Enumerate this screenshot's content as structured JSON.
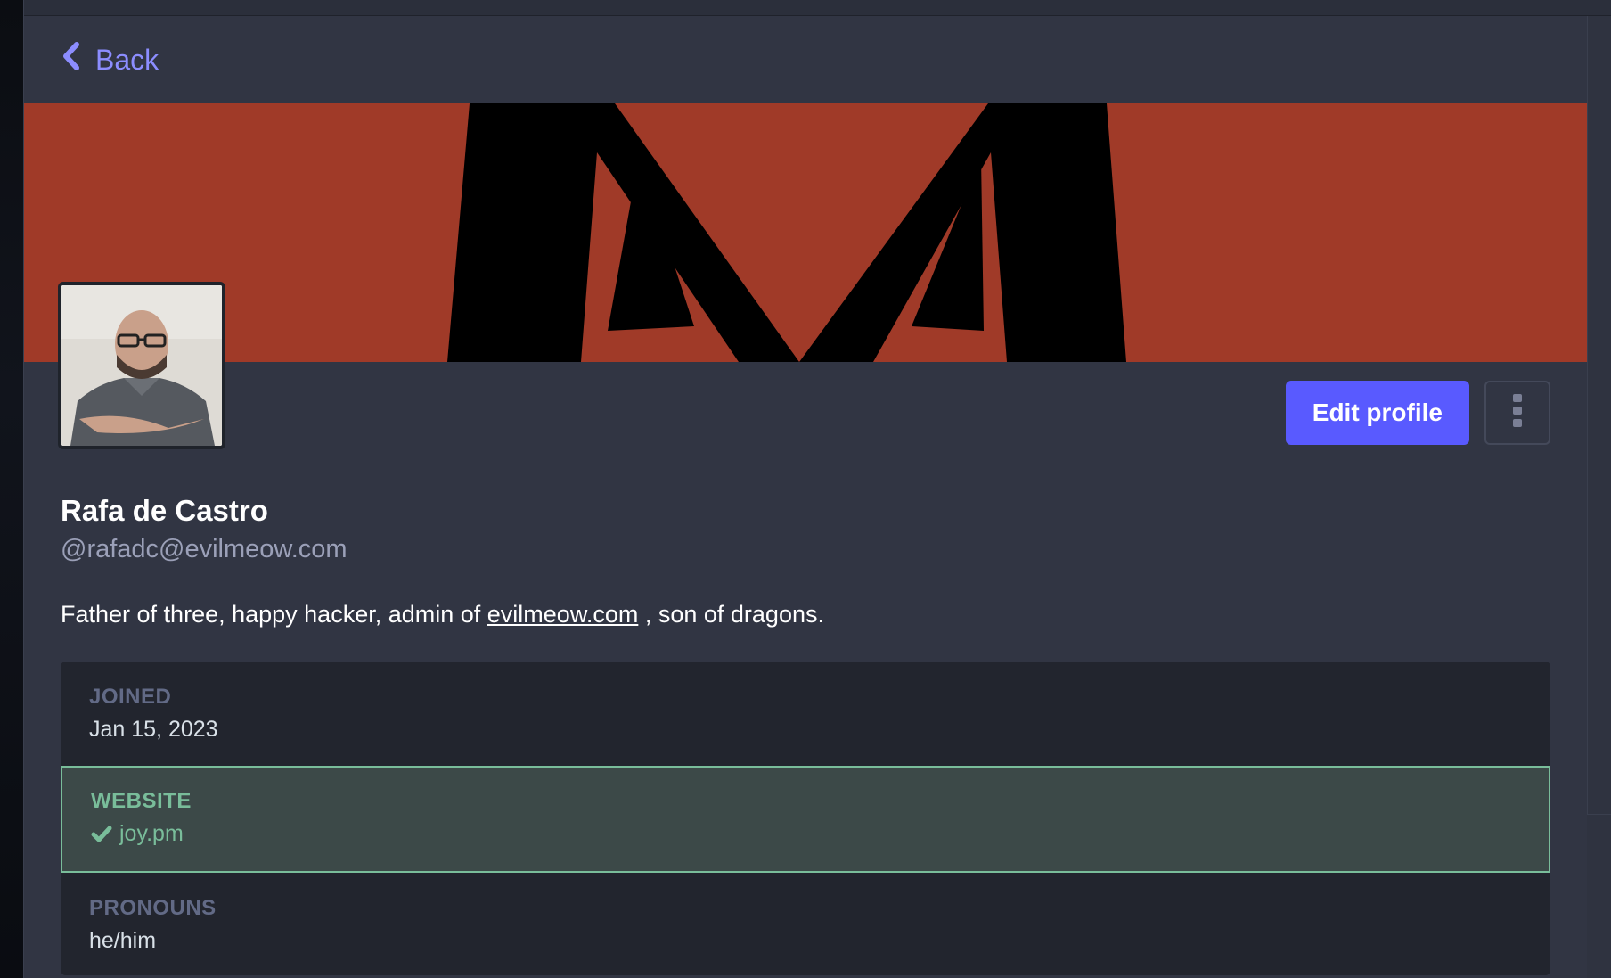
{
  "colors": {
    "accent": "#595aff",
    "link": "#8c8dff",
    "header_red": "#a03a28",
    "verified_green": "#79bd9a",
    "panel": "#313543",
    "field_bg": "#22252e"
  },
  "nav": {
    "back_label": "Back",
    "back_icon": "chevron-left-icon"
  },
  "profile": {
    "display_name": "Rafa de Castro",
    "acct": "@rafadc@evilmeow.com",
    "bio_before": "Father of three, happy hacker, admin of ",
    "bio_link": "evilmeow.com",
    "bio_after": " , son of dragons."
  },
  "actions": {
    "edit_label": "Edit profile",
    "more_icon": "ellipsis-vertical-icon"
  },
  "fields": [
    {
      "label": "JOINED",
      "value": "Jan 15, 2023",
      "verified": false
    },
    {
      "label": "WEBSITE",
      "value": "joy.pm",
      "verified": true,
      "icon": "check-icon"
    },
    {
      "label": "PRONOUNS",
      "value": "he/him",
      "verified": false
    }
  ]
}
